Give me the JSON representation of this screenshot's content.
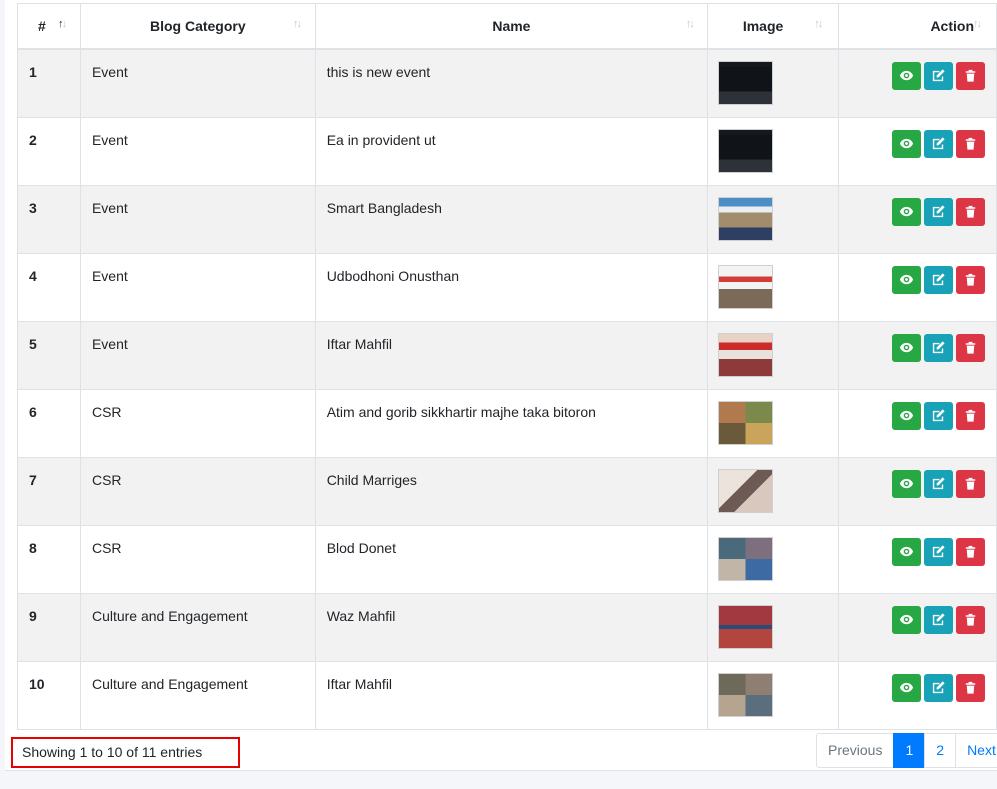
{
  "table": {
    "headers": {
      "num": "#",
      "category": "Blog Category",
      "name": "Name",
      "image": "Image",
      "action": "Action"
    },
    "rows": [
      {
        "num": "1",
        "category": "Event",
        "name": "this is new event",
        "thumb": "dark-slide"
      },
      {
        "num": "2",
        "category": "Event",
        "name": "Ea in provident ut",
        "thumb": "dark-slide"
      },
      {
        "num": "3",
        "category": "Event",
        "name": "Smart Bangladesh",
        "thumb": "seminar-photo"
      },
      {
        "num": "4",
        "category": "Event",
        "name": "Udbodhoni Onusthan",
        "thumb": "banner-photo"
      },
      {
        "num": "5",
        "category": "Event",
        "name": "Iftar Mahfil",
        "thumb": "red-banner-photo"
      },
      {
        "num": "6",
        "category": "CSR",
        "name": "Atim and gorib sikkhartir majhe taka bitoron",
        "thumb": "collage-photo"
      },
      {
        "num": "7",
        "category": "CSR",
        "name": "Child Marriges",
        "thumb": "room-photo"
      },
      {
        "num": "8",
        "category": "CSR",
        "name": "Blod Donet",
        "thumb": "blood-collage-photo"
      },
      {
        "num": "9",
        "category": "Culture and Engagement",
        "name": "Waz Mahfil",
        "thumb": "waz-collage-photo"
      },
      {
        "num": "10",
        "category": "Culture and Engagement",
        "name": "Iftar Mahfil",
        "thumb": "iftar-collage-photo"
      }
    ]
  },
  "footer": {
    "info": "Showing 1 to 10 of 11 entries",
    "previous": "Previous",
    "pages": [
      "1",
      "2"
    ],
    "active_page": "1",
    "next": "Next"
  },
  "colors": {
    "view": "#28a745",
    "edit": "#17a2b8",
    "delete": "#dc3545",
    "primary": "#007bff",
    "highlight_border": "#e60000"
  }
}
